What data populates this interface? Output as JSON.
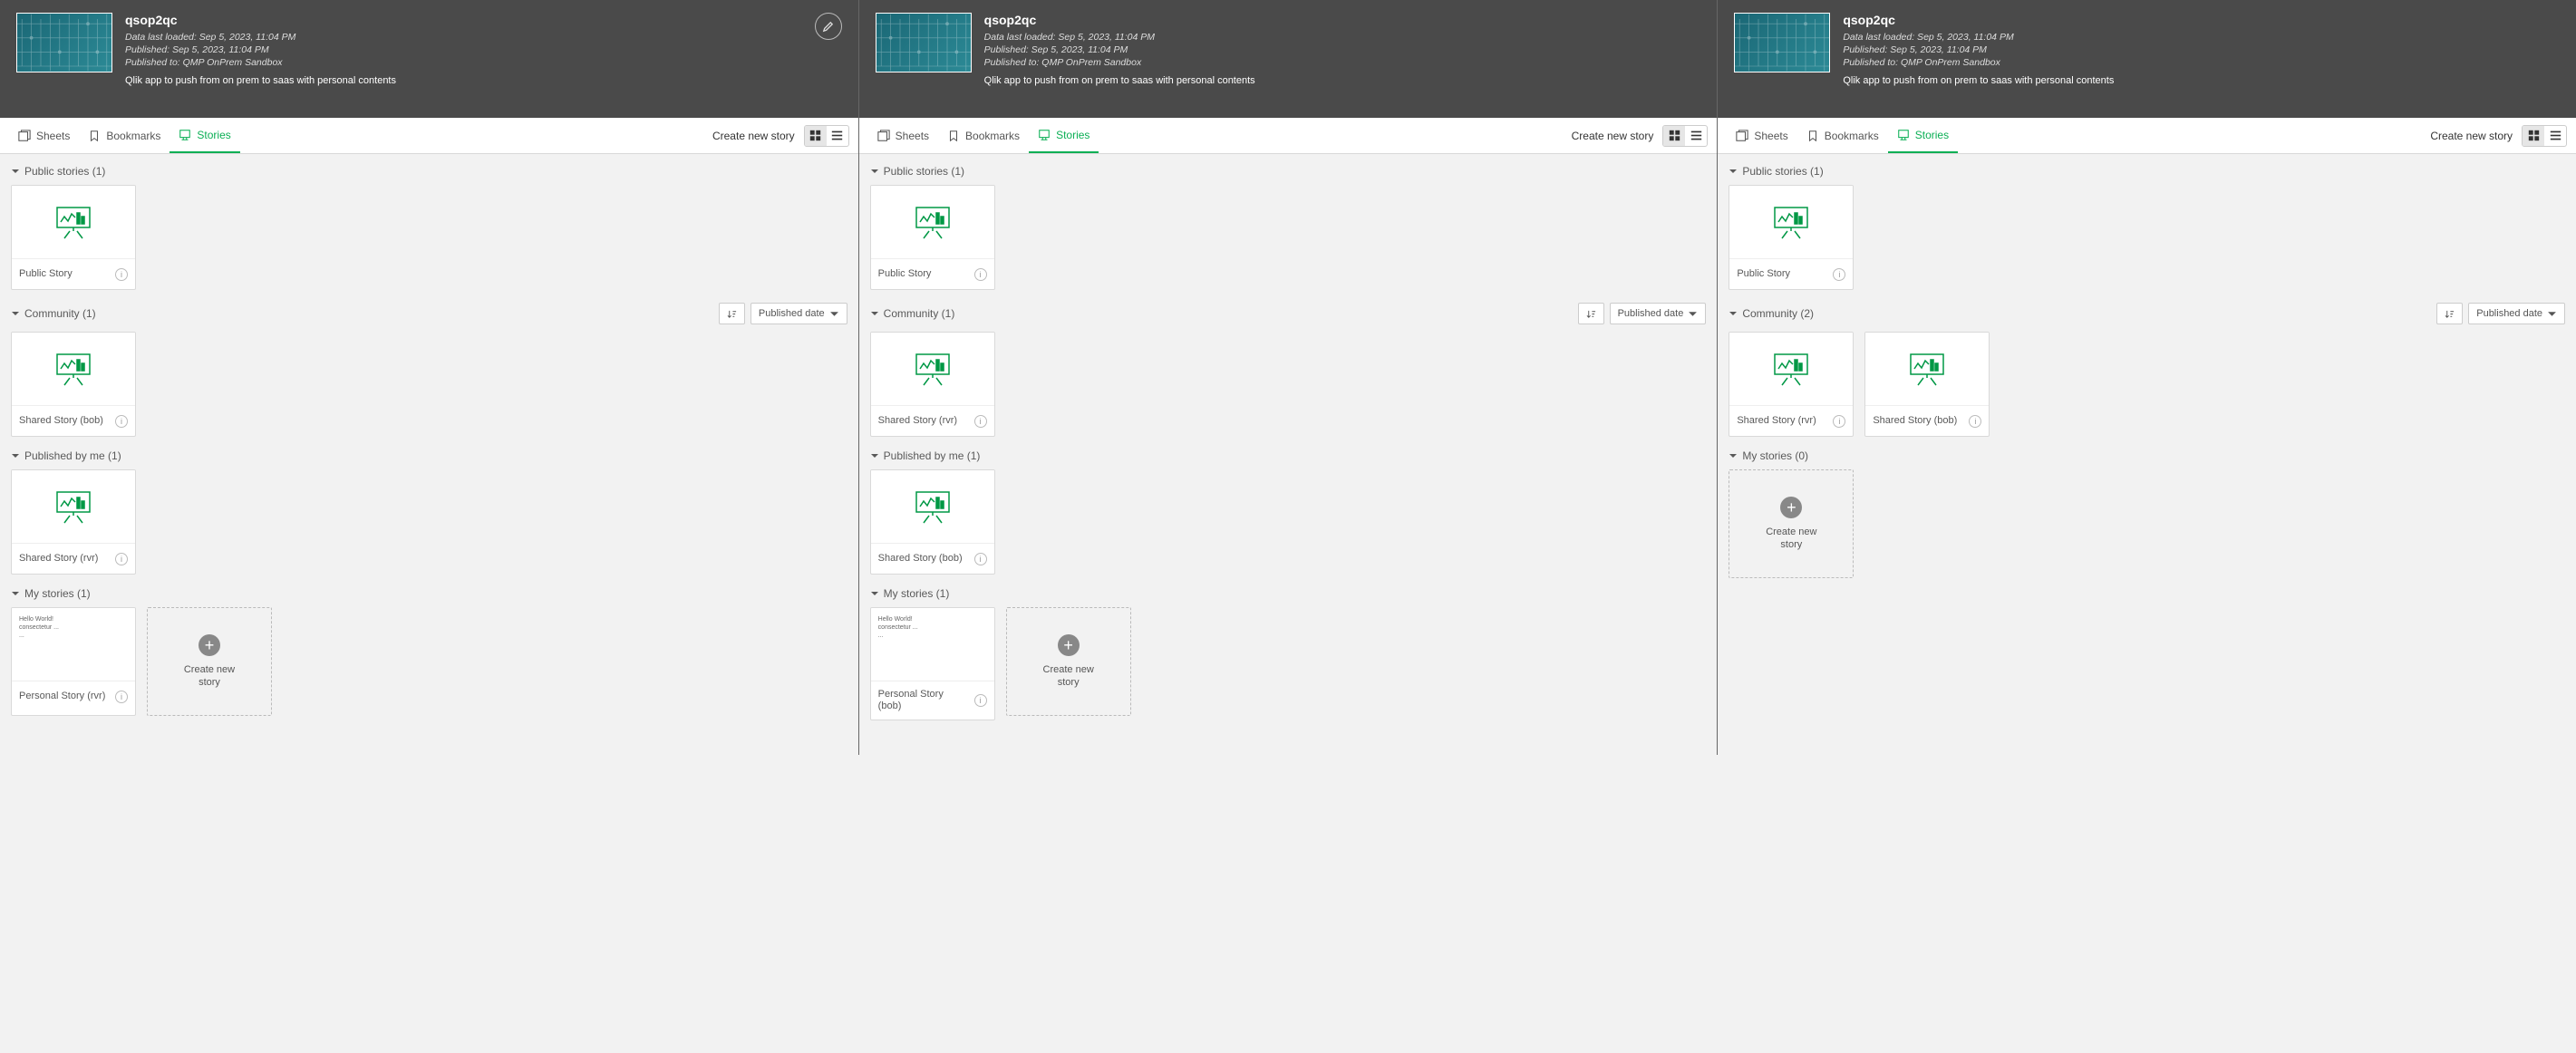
{
  "app": {
    "title": "qsop2qc",
    "data_loaded": "Data last loaded: Sep 5, 2023, 11:04 PM",
    "published": "Published: Sep 5, 2023, 11:04 PM",
    "published_to": "Published to: QMP OnPrem Sandbox",
    "description": "Qlik app to push from on prem to saas with personal contents"
  },
  "tabs": {
    "sheets": "Sheets",
    "bookmarks": "Bookmarks",
    "stories": "Stories"
  },
  "create": "Create new story",
  "sort_label": "Published date",
  "panes": [
    {
      "edit": true,
      "sections": [
        {
          "title": "Public stories (1)",
          "sort": false,
          "cards": [
            {
              "type": "chart",
              "name": "Public Story"
            }
          ]
        },
        {
          "title": "Community (1)",
          "sort": true,
          "cards": [
            {
              "type": "chart",
              "name": "Shared Story (bob)"
            }
          ]
        },
        {
          "title": "Published by me (1)",
          "sort": false,
          "cards": [
            {
              "type": "chart",
              "name": "Shared Story (rvr)"
            }
          ]
        },
        {
          "title": "My stories (1)",
          "sort": false,
          "cards": [
            {
              "type": "text",
              "name": "Personal Story (rvr)"
            }
          ],
          "new": true
        }
      ]
    },
    {
      "edit": false,
      "sections": [
        {
          "title": "Public stories (1)",
          "sort": false,
          "cards": [
            {
              "type": "chart",
              "name": "Public Story"
            }
          ]
        },
        {
          "title": "Community (1)",
          "sort": true,
          "cards": [
            {
              "type": "chart",
              "name": "Shared Story (rvr)"
            }
          ]
        },
        {
          "title": "Published by me (1)",
          "sort": false,
          "cards": [
            {
              "type": "chart",
              "name": "Shared Story (bob)"
            }
          ]
        },
        {
          "title": "My stories (1)",
          "sort": false,
          "cards": [
            {
              "type": "text",
              "name": "Personal Story (bob)"
            }
          ],
          "new": true
        }
      ]
    },
    {
      "edit": false,
      "sections": [
        {
          "title": "Public stories (1)",
          "sort": false,
          "cards": [
            {
              "type": "chart",
              "name": "Public Story"
            }
          ]
        },
        {
          "title": "Community (2)",
          "sort": true,
          "cards": [
            {
              "type": "chart",
              "name": "Shared Story (rvr)"
            },
            {
              "type": "chart",
              "name": "Shared Story (bob)"
            }
          ]
        },
        {
          "title": "My stories (0)",
          "sort": false,
          "cards": [],
          "new": true
        }
      ]
    }
  ]
}
